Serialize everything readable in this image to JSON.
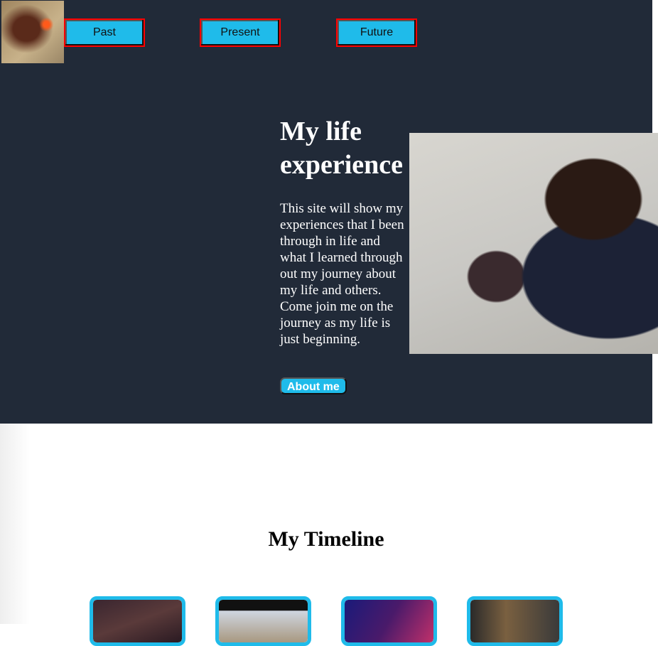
{
  "nav": {
    "items": [
      {
        "label": "Past"
      },
      {
        "label": "Present"
      },
      {
        "label": "Future"
      }
    ]
  },
  "hero": {
    "title": "My life experience",
    "intro_1": "This site will show my experiences that I been through in life and what I learned through out my journey about my life and others.",
    "intro_2": "Come join me on the journey as my life is just beginning.",
    "about_button": "About me"
  },
  "timeline": {
    "title": "My Timeline"
  },
  "colors": {
    "accent": "#1fbbea",
    "hero_bg": "#212a38",
    "nav_border": "#ff0000"
  }
}
